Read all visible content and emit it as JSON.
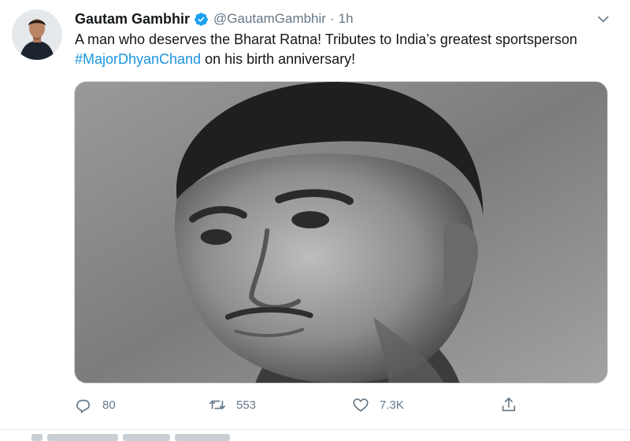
{
  "tweet": {
    "display_name": "Gautam Gambhir",
    "verified_icon": "verified-badge-icon",
    "handle": "@GautamGambhir",
    "separator": "·",
    "time": "1h",
    "text_part1": "A man who deserves the Bharat Ratna! Tributes to India’s greatest sportsperson ",
    "hashtag": "#MajorDhyanChand",
    "text_part2": " on his birth anniversary!",
    "colors": {
      "link": "#1b95e0",
      "muted": "#657786",
      "verified": "#1da1f2"
    }
  },
  "actions": {
    "reply_count": "80",
    "retweet_count": "553",
    "like_count": "7.3K",
    "icons": [
      "reply-icon",
      "retweet-icon",
      "like-icon",
      "share-icon"
    ]
  }
}
